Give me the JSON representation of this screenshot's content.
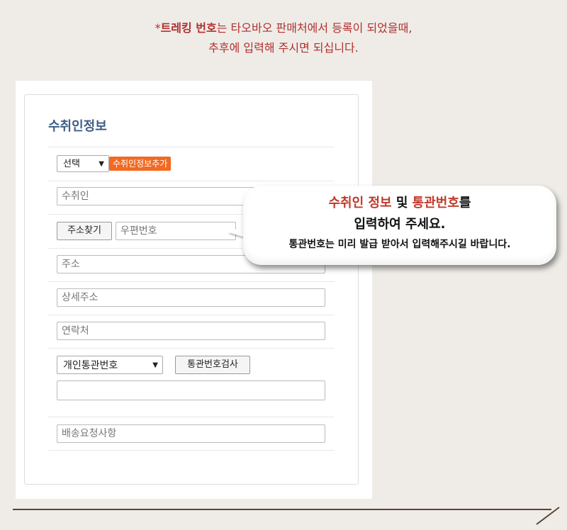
{
  "notice": {
    "prefix": "*",
    "bold": "트레킹 번호",
    "rest": "는 타오바오 판매처에서 등록이 되었을때,",
    "line2": "추후에 입력해 주시면 되십니다."
  },
  "form": {
    "title": "수취인정보",
    "select_default": "선택",
    "add_button": "수취인정보추가",
    "recipient_placeholder": "수취인",
    "address_search_button": "주소찾기",
    "postal_placeholder": "우편번호",
    "address_placeholder": "주소",
    "address_detail_placeholder": "상세주소",
    "contact_placeholder": "연락처",
    "customs_type_select": "개인통관번호",
    "customs_check_button": "통관번호검사",
    "customs_number_value": "",
    "delivery_request_placeholder": "배송요청사항"
  },
  "bubble": {
    "part1": "수취인 정보",
    "part2": " 및 ",
    "part3": "통관번호",
    "part4": "를",
    "line2": "입력하여 주세요.",
    "line3": "통관번호는 미리 발급 받아서 입력해주시길 바랍니다."
  },
  "colors": {
    "notice": "#b03030",
    "title": "#3e5f86",
    "add_button": "#f26a21",
    "background": "#efece7"
  }
}
